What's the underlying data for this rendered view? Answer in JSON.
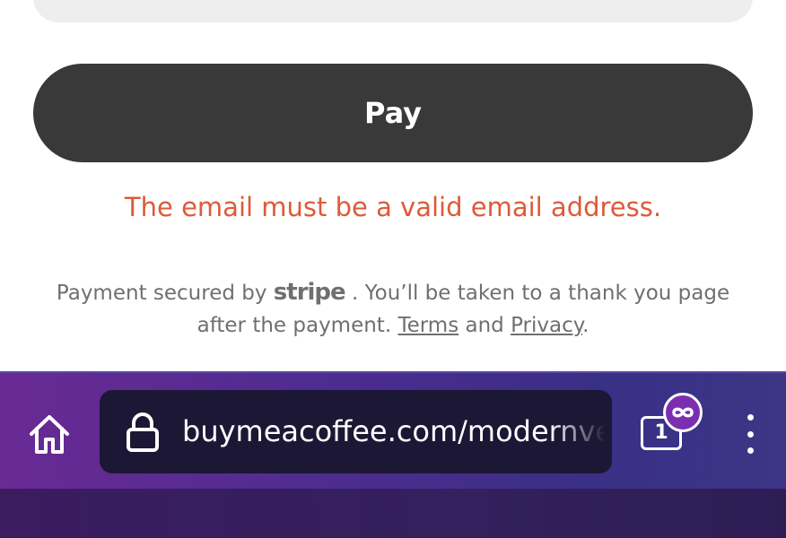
{
  "payment": {
    "pay_label": "Pay",
    "error_message": "The email must be a valid email address.",
    "secure_prefix": "Payment secured by",
    "stripe_brand": "stripe",
    "secure_suffix": ". You’ll be taken to a thank you page after the payment.",
    "terms_link": "Terms",
    "and_text": "and",
    "privacy_link": "Privacy",
    "period": "."
  },
  "browser": {
    "url": "buymeacoffee.com/modernvestor",
    "tab_count": "1",
    "home_icon": "home-icon",
    "lock_icon": "lock-icon",
    "tabs_icon": "tabs-icon",
    "badge_icon": "infinity-mask-icon",
    "menu_icon": "more-vertical-icon"
  },
  "colors": {
    "pay_button": "#393939",
    "error_text": "#dd5a3a",
    "muted_text": "#6f6f6f",
    "toolbar_gradient_start": "#6a2a94",
    "toolbar_gradient_end": "#3b3685",
    "url_field": "#1c1734"
  }
}
